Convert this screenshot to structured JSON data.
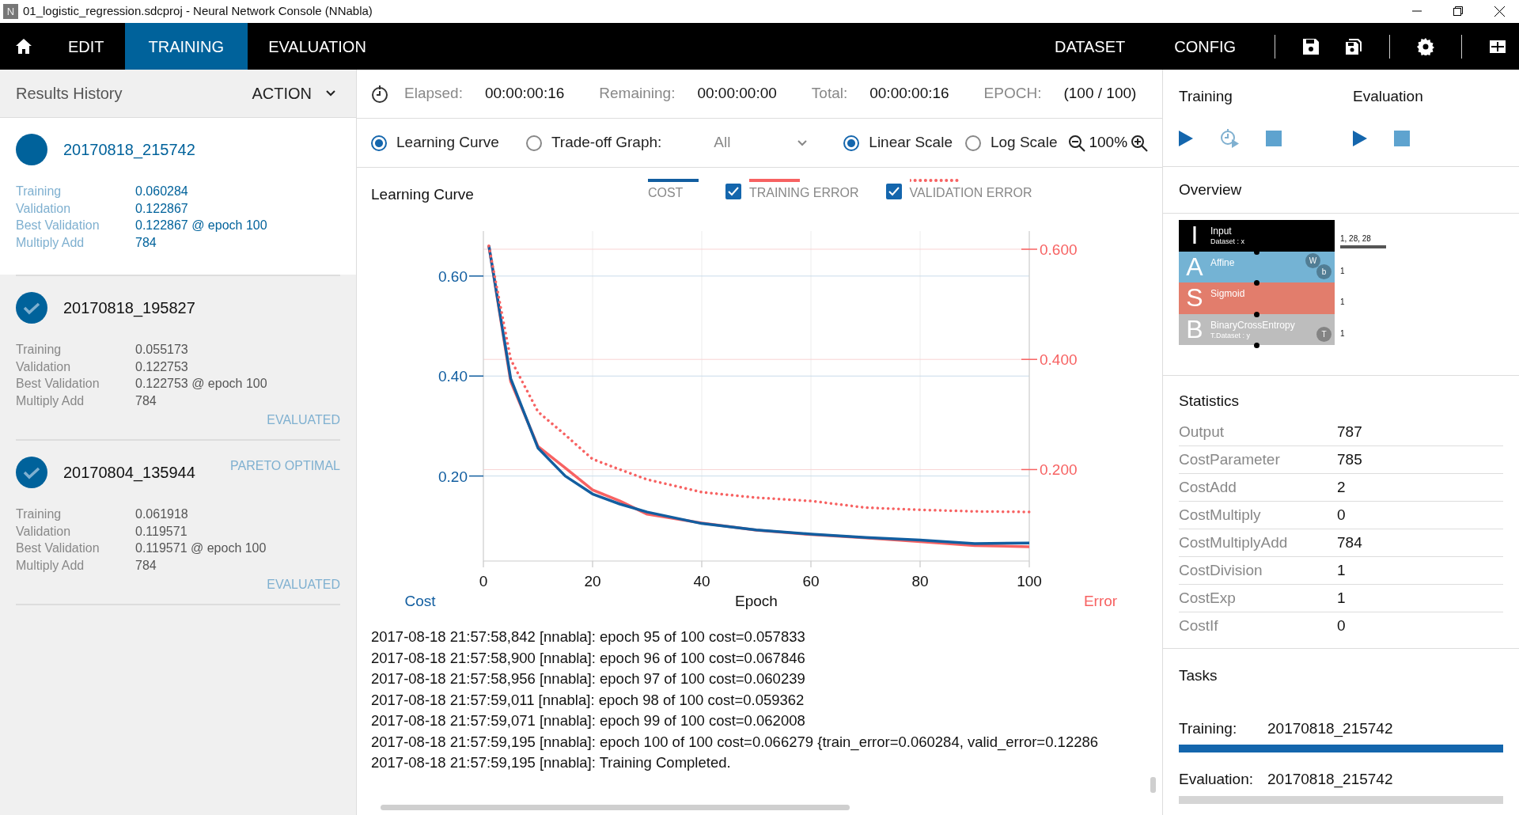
{
  "window": {
    "app_icon_letter": "N",
    "title": "01_logistic_regression.sdcproj - Neural Network Console (NNabla)"
  },
  "nav": {
    "tabs": [
      {
        "label": "EDIT",
        "selected": false
      },
      {
        "label": "TRAINING",
        "selected": true
      },
      {
        "label": "EVALUATION",
        "selected": false
      }
    ],
    "right_items": [
      "DATASET",
      "CONFIG"
    ]
  },
  "results_history": {
    "title": "Results History",
    "action": "ACTION",
    "items": [
      {
        "name": "20170818_215742",
        "selected": true,
        "done": false,
        "stats": [
          {
            "label": "Training",
            "value": "0.060284"
          },
          {
            "label": "Validation",
            "value": "0.122867"
          },
          {
            "label": "Best Validation",
            "value": "0.122867 @ epoch 100"
          },
          {
            "label": "Multiply Add",
            "value": "784"
          }
        ]
      },
      {
        "name": "20170818_195827",
        "selected": false,
        "done": true,
        "status": "EVALUATED",
        "stats": [
          {
            "label": "Training",
            "value": "0.055173"
          },
          {
            "label": "Validation",
            "value": "0.122753"
          },
          {
            "label": "Best Validation",
            "value": "0.122753 @ epoch 100"
          },
          {
            "label": "Multiply Add",
            "value": "784"
          }
        ]
      },
      {
        "name": "20170804_135944",
        "selected": false,
        "done": true,
        "tag": "PARETO OPTIMAL",
        "status": "EVALUATED",
        "stats": [
          {
            "label": "Training",
            "value": "0.061918"
          },
          {
            "label": "Validation",
            "value": "0.119571"
          },
          {
            "label": "Best Validation",
            "value": "0.119571 @ epoch 100"
          },
          {
            "label": "Multiply Add",
            "value": "784"
          }
        ]
      }
    ]
  },
  "timers": [
    {
      "label": "Elapsed:",
      "value": "00:00:00:16"
    },
    {
      "label": "Remaining:",
      "value": "00:00:00:00"
    },
    {
      "label": "Total:",
      "value": "00:00:00:16"
    },
    {
      "label": "EPOCH:",
      "value": "(100 / 100)"
    }
  ],
  "graph_modes": [
    {
      "label": "Learning Curve",
      "selected": true
    },
    {
      "label": "Trade-off Graph:",
      "selected": false
    }
  ],
  "tradeoff_filter": {
    "value": "All"
  },
  "scales": [
    {
      "label": "Linear Scale",
      "selected": true
    },
    {
      "label": "Log Scale",
      "selected": false
    }
  ],
  "zoom": "100%",
  "legend": [
    {
      "kind": "plain"
    },
    {
      "kind": "toggle",
      "checked": true
    },
    {
      "kind": "toggle",
      "checked": true
    }
  ],
  "chart_data": {
    "type": "line",
    "title": "Learning Curve",
    "xlabel": "Epoch",
    "ylabel": "Cost",
    "y2label": "Error",
    "x": [
      1,
      5,
      10,
      15,
      20,
      25,
      30,
      40,
      50,
      60,
      70,
      80,
      90,
      100
    ],
    "grid": true,
    "legend": "top",
    "xlim": [
      0,
      100
    ],
    "ylim": [
      0.03,
      0.69
    ],
    "y2lim": [
      0.034,
      0.633
    ],
    "xticks": [
      0,
      20,
      40,
      60,
      80,
      100
    ],
    "yticks": [
      {
        "value": 0.2,
        "label": "0.20"
      },
      {
        "value": 0.4,
        "label": "0.40"
      },
      {
        "value": 0.6,
        "label": "0.60"
      }
    ],
    "y2ticks": [
      {
        "value": 0.2,
        "label": "0.200"
      },
      {
        "value": 0.4,
        "label": "0.400"
      },
      {
        "value": 0.6,
        "label": "0.600"
      }
    ],
    "series": [
      {
        "name": "COST",
        "color": "#125ea0",
        "values": [
          0.661,
          0.395,
          0.256,
          0.2,
          0.164,
          0.144,
          0.128,
          0.105,
          0.092,
          0.084,
          0.077,
          0.072,
          0.065,
          0.066
        ]
      },
      {
        "name": "TRAINING ERROR",
        "color": "#f76262",
        "axis": "y2",
        "values": [
          0.606,
          0.36,
          0.242,
          0.203,
          0.163,
          0.143,
          0.119,
          0.103,
          0.09,
          0.082,
          0.076,
          0.069,
          0.062,
          0.06
        ]
      },
      {
        "name": "VALIDATION ERROR",
        "color": "#f76262",
        "axis": "y2",
        "line_style": "dotted",
        "values": [
          0.606,
          0.4,
          0.305,
          0.263,
          0.219,
          0.2,
          0.182,
          0.159,
          0.149,
          0.143,
          0.131,
          0.127,
          0.124,
          0.123
        ]
      }
    ]
  },
  "log_lines": [
    "2017-08-18 21:57:58,842 [nnabla]: epoch 95 of 100 cost=0.057833",
    "2017-08-18 21:57:58,900 [nnabla]: epoch 96 of 100 cost=0.067846",
    "2017-08-18 21:57:58,956 [nnabla]: epoch 97 of 100 cost=0.060239",
    "2017-08-18 21:57:59,011 [nnabla]: epoch 98 of 100 cost=0.059362",
    "2017-08-18 21:57:59,071 [nnabla]: epoch 99 of 100 cost=0.062008",
    "2017-08-18 21:57:59,195 [nnabla]: epoch 100 of 100 cost=0.066279  {train_error=0.060284, valid_error=0.12286",
    "2017-08-18 21:57:59,195 [nnabla]: Training Completed."
  ],
  "controls": {
    "training_title": "Training",
    "evaluation_title": "Evaluation"
  },
  "overview": {
    "title": "Overview",
    "layers": [
      {
        "letter": "I",
        "name": "Input",
        "source": "Dataset : x",
        "color": "#000000",
        "shape": "1, 28, 28"
      },
      {
        "letter": "A",
        "name": "Affine",
        "color": "#74b3d4",
        "shape": "1",
        "params": [
          "W",
          "b"
        ]
      },
      {
        "letter": "S",
        "name": "Sigmoid",
        "color": "#e27d6c",
        "shape": "1"
      },
      {
        "letter": "B",
        "name": "BinaryCrossEntropy",
        "source": "T.Dataset : y",
        "color": "#bdbdbd",
        "shape": "1",
        "params": [
          "T"
        ]
      }
    ]
  },
  "statistics": {
    "title": "Statistics",
    "rows": [
      {
        "label": "Output",
        "value": "787"
      },
      {
        "label": "CostParameter",
        "value": "785"
      },
      {
        "label": "CostAdd",
        "value": "2"
      },
      {
        "label": "CostMultiply",
        "value": "0"
      },
      {
        "label": "CostMultiplyAdd",
        "value": "784"
      },
      {
        "label": "CostDivision",
        "value": "1"
      },
      {
        "label": "CostExp",
        "value": "1"
      },
      {
        "label": "CostIf",
        "value": "0"
      }
    ]
  },
  "tasks": {
    "title": "Tasks",
    "items": [
      {
        "label": "Training:",
        "value": "20170818_215742",
        "level": 1
      },
      {
        "label": "Evaluation:",
        "value": "20170818_215742",
        "level": 0
      }
    ]
  }
}
